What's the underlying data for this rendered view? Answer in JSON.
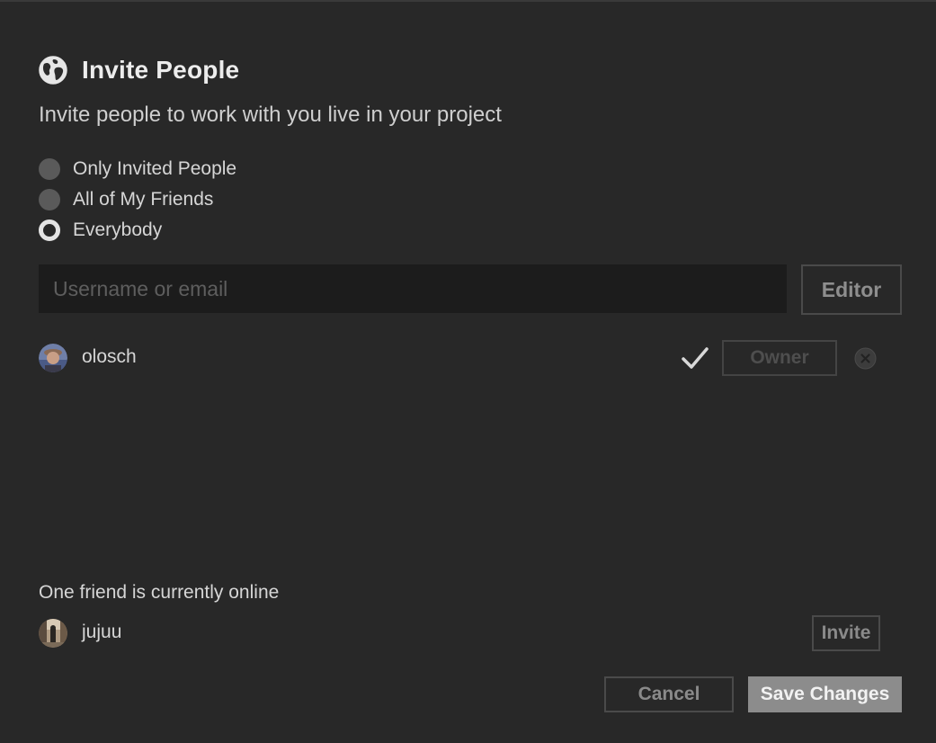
{
  "dialog": {
    "title": "Invite People",
    "title_icon": "globe-icon",
    "subtitle": "Invite people to work with you live in your project"
  },
  "visibility": {
    "options": [
      {
        "label": "Only Invited People",
        "selected": false
      },
      {
        "label": "All of My Friends",
        "selected": false
      },
      {
        "label": "Everybody",
        "selected": true
      }
    ]
  },
  "search": {
    "placeholder": "Username or email",
    "value": ""
  },
  "role_select": {
    "value": "Editor"
  },
  "members": [
    {
      "name": "olosch",
      "avatar": "user-avatar",
      "status_icon": "check-icon",
      "role": "Owner",
      "remove_icon": "remove-icon"
    }
  ],
  "online": {
    "text": "One friend is currently online",
    "friends": [
      {
        "name": "jujuu",
        "avatar": "user-avatar",
        "action": "Invite"
      }
    ]
  },
  "footer": {
    "cancel_label": "Cancel",
    "save_label": "Save Changes"
  },
  "colors": {
    "background": "#282828",
    "input_background": "#1c1c1c",
    "primary_button": "#8c8c8c",
    "border": "#4a4a4a"
  }
}
